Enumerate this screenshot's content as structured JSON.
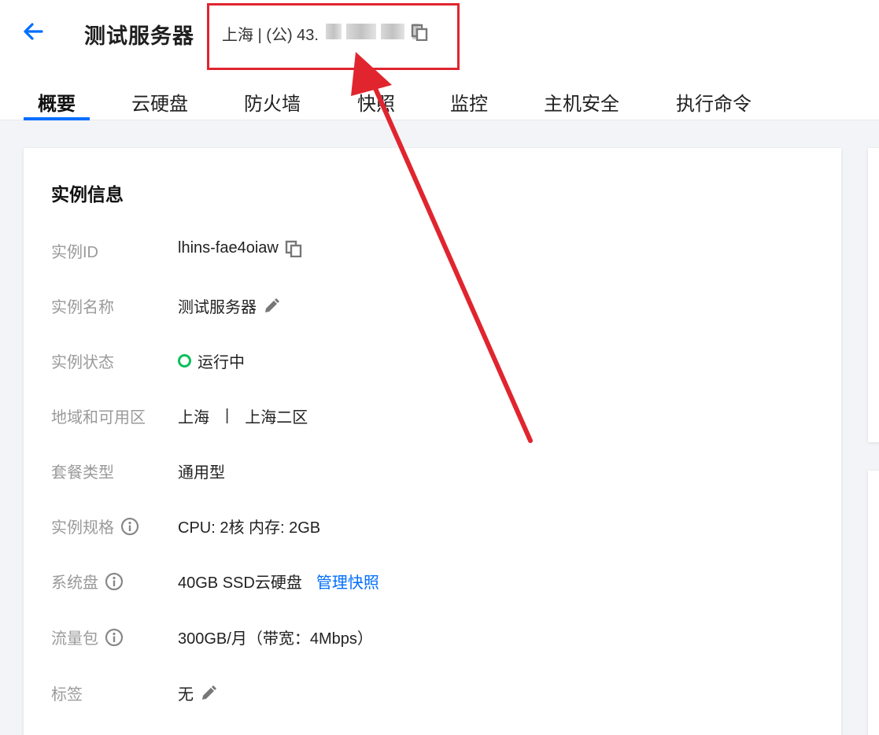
{
  "header": {
    "title": "测试服务器",
    "ip_prefix": "上海 | (公) 43.",
    "ip_redacted": true
  },
  "tabs": [
    {
      "label": "概要",
      "active": true
    },
    {
      "label": "云硬盘",
      "active": false
    },
    {
      "label": "防火墙",
      "active": false
    },
    {
      "label": "快照",
      "active": false
    },
    {
      "label": "监控",
      "active": false
    },
    {
      "label": "主机安全",
      "active": false
    },
    {
      "label": "执行命令",
      "active": false
    }
  ],
  "instance_info": {
    "title": "实例信息",
    "rows": [
      {
        "label": "实例ID",
        "value": "lhins-fae4oiaw"
      },
      {
        "label": "实例名称",
        "value": "测试服务器"
      },
      {
        "label": "实例状态",
        "value": "运行中"
      },
      {
        "label": "地域和可用区",
        "value": "上海",
        "value2": "上海二区",
        "separator": "|"
      },
      {
        "label": "套餐类型",
        "value": "通用型"
      },
      {
        "label": "实例规格",
        "value": "CPU: 2核 内存: 2GB"
      },
      {
        "label": "系统盘",
        "value": "40GB SSD云硬盘",
        "link": "管理快照"
      },
      {
        "label": "流量包",
        "value": "300GB/月（带宽：4Mbps）"
      },
      {
        "label": "标签",
        "value": "无"
      }
    ]
  },
  "colors": {
    "accent": "#006eff",
    "status_running": "#0abf5b",
    "annotation": "#e0252f"
  },
  "icons": {
    "back": "arrow-left-icon",
    "copy": "copy-icon",
    "edit": "pencil-icon",
    "info": "info-circle-icon"
  }
}
